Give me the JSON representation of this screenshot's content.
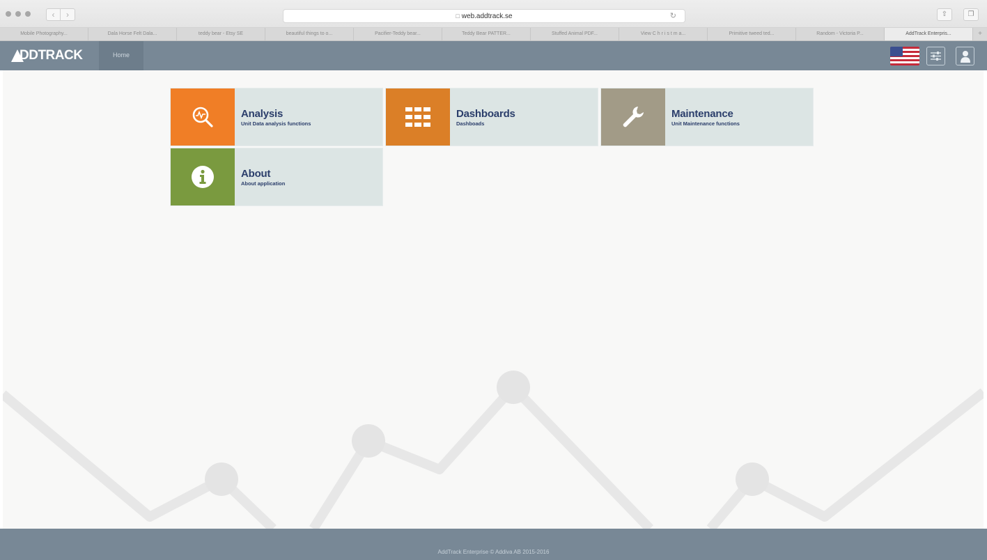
{
  "browser": {
    "url": "web.addtrack.se",
    "tabs": [
      "Mobile Photography...",
      "Dala Horse Felt Dala...",
      "teddy bear - Etsy SE",
      "beautiful things to o...",
      "Pacifier-Teddy bear...",
      "Teddy Bear PATTER...",
      "Stuffed Animal PDF...",
      "View C h r i s t m a...",
      "Primitive tweed ted...",
      "Random - Victoria P...",
      "AddTrack Enterpris..."
    ],
    "new_tab_label": "+"
  },
  "header": {
    "logo_text": "DDTRACK",
    "home_label": "Home",
    "icons": [
      "us-flag-icon",
      "settings-sliders-icon",
      "user-profile-icon"
    ]
  },
  "tiles": [
    {
      "title": "Analysis",
      "subtitle": "Unit Data analysis functions",
      "icon": "magnifier-chart-icon",
      "color": "#f07e26"
    },
    {
      "title": "Dashboards",
      "subtitle": "Dashboads",
      "icon": "grid-icon",
      "color": "#db7f27"
    },
    {
      "title": "Maintenance",
      "subtitle": "Unit Maintenance functions",
      "icon": "wrench-icon",
      "color": "#a29b87"
    },
    {
      "title": "About",
      "subtitle": "About application",
      "icon": "info-icon",
      "color": "#7a9a3f"
    }
  ],
  "footer": {
    "text": "AddTrack Enterprise © Addiva AB 2015-2016"
  },
  "colors": {
    "header_bg": "#788896",
    "tile_bg": "#dce5e4",
    "tile_text": "#2b3e6b",
    "background_graphic": "#e7e7e7"
  }
}
